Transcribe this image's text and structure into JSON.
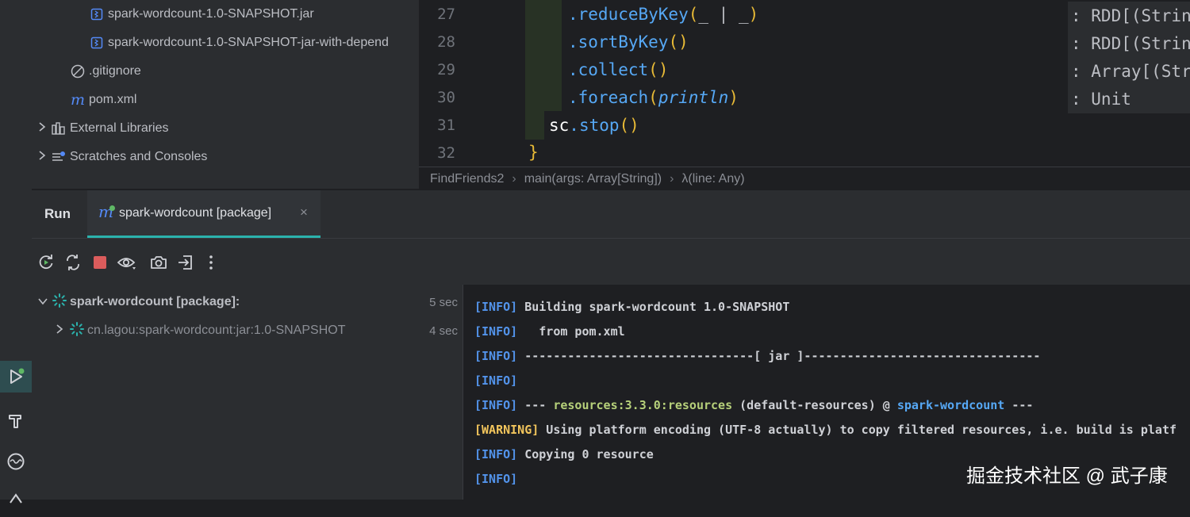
{
  "project_tree": {
    "items": [
      {
        "label": "spark-wordcount-1.0-SNAPSHOT.jar",
        "icon": "jar-file-icon"
      },
      {
        "label": "spark-wordcount-1.0-SNAPSHOT-jar-with-depend",
        "icon": "jar-file-icon"
      },
      {
        "label": ".gitignore",
        "icon": "ignore-file-icon"
      },
      {
        "label": "pom.xml",
        "icon": "maven-icon"
      },
      {
        "label": "External Libraries",
        "icon": "library-icon"
      },
      {
        "label": "Scratches and Consoles",
        "icon": "scratches-icon"
      }
    ]
  },
  "editor": {
    "line_numbers": [
      "27",
      "28",
      "29",
      "30",
      "31",
      "32"
    ],
    "lines": [
      {
        "method": ".reduceByKey",
        "open": "(",
        "args": "_ | _",
        "close": ")",
        "hint": ": RDD[(String"
      },
      {
        "method": ".sortByKey",
        "open": "(",
        "args": "",
        "close": ")",
        "hint": ": RDD[(String"
      },
      {
        "method": ".collect",
        "open": "(",
        "args": "",
        "close": ")",
        "hint": ": Array[(Stri"
      },
      {
        "method": ".foreach",
        "open": "(",
        "args": "println",
        "close": ")",
        "hint": ": Unit"
      },
      {
        "obj": "sc",
        "method": ".stop",
        "open": "(",
        "close": ")"
      },
      {
        "brace": "}"
      }
    ]
  },
  "breadcrumb": [
    "FindFriends2",
    "main(args: Array[String])",
    "λ(line: Any)"
  ],
  "run_panel": {
    "title": "Run",
    "tab_label": "spark-wordcount [package]",
    "close_symbol": "×"
  },
  "build_tree": [
    {
      "label": "spark-wordcount [package]:",
      "time": "5 sec"
    },
    {
      "label": "cn.lagou:spark-wordcount:jar:1.0-SNAPSHOT",
      "time": "4 sec"
    }
  ],
  "console": {
    "lines": [
      {
        "level": "[INFO]",
        "text": " Building spark-wordcount 1.0-SNAPSHOT"
      },
      {
        "level": "[INFO]",
        "text": "   from pom.xml"
      },
      {
        "level": "[INFO]",
        "text": " --------------------------------[ jar ]---------------------------------"
      },
      {
        "level": "[INFO]",
        "text": ""
      },
      {
        "level": "[INFO]",
        "pre": " --- ",
        "plugin": "resources:3.3.0:resources",
        "mid": " (default-resources) @ ",
        "artifact": "spark-wordcount",
        "post": " ---"
      },
      {
        "level": "[WARNING]",
        "text": " Using platform encoding (UTF-8 actually) to copy filtered resources, i.e. build is platf"
      },
      {
        "level": "[INFO]",
        "text": " Copying 0 resource"
      },
      {
        "level": "[INFO]",
        "text": ""
      }
    ]
  },
  "watermark": "掘金技术社区 @ 武子康",
  "colors": {
    "accent": "#2bb3ad",
    "stop_red": "#db5c5c",
    "info_blue": "#5394ec",
    "warning_yellow": "#f2c55c"
  }
}
